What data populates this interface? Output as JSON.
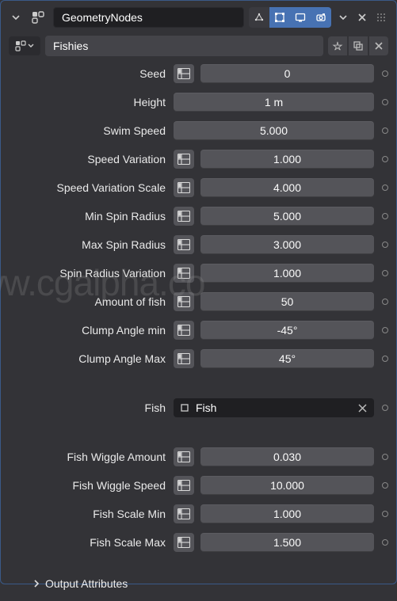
{
  "header": {
    "modifier_name": "GeometryNodes"
  },
  "nodegroup": {
    "name": "Fishies"
  },
  "props": [
    {
      "label": "Seed",
      "value": "0",
      "has_chip": true
    },
    {
      "label": "Height",
      "value": "1 m",
      "has_chip": false
    },
    {
      "label": "Swim Speed",
      "value": "5.000",
      "has_chip": false
    },
    {
      "label": "Speed Variation",
      "value": "1.000",
      "has_chip": true
    },
    {
      "label": "Speed Variation Scale",
      "value": "4.000",
      "has_chip": true
    },
    {
      "label": "Min Spin Radius",
      "value": "5.000",
      "has_chip": true
    },
    {
      "label": "Max Spin Radius",
      "value": "3.000",
      "has_chip": true
    },
    {
      "label": "Spin Radius Variation",
      "value": "1.000",
      "has_chip": true
    },
    {
      "label": "Amount of fish",
      "value": "50",
      "has_chip": true
    },
    {
      "label": "Clump Angle min",
      "value": "-45°",
      "has_chip": true
    },
    {
      "label": "Clump Angle Max",
      "value": "45°",
      "has_chip": true
    }
  ],
  "fish_row": {
    "label": "Fish",
    "object_name": "Fish"
  },
  "props2": [
    {
      "label": "Fish Wiggle Amount",
      "value": "0.030",
      "has_chip": true
    },
    {
      "label": "Fish Wiggle Speed",
      "value": "10.000",
      "has_chip": true
    },
    {
      "label": "Fish Scale Min",
      "value": "1.000",
      "has_chip": true
    },
    {
      "label": "Fish Scale Max",
      "value": "1.500",
      "has_chip": true
    }
  ],
  "footer": {
    "output_attributes": "Output Attributes"
  },
  "watermark": "www.cgalpha.co"
}
